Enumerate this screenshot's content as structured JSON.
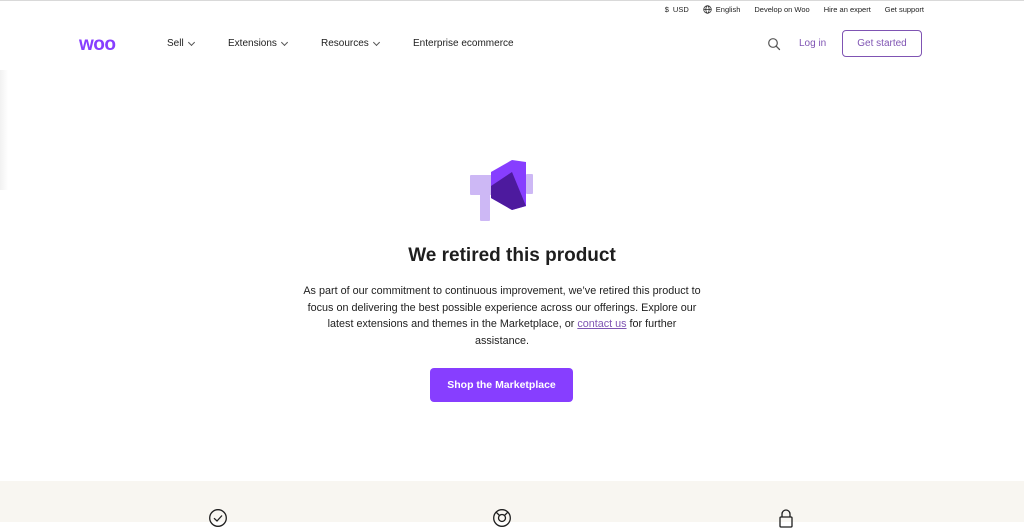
{
  "utility_bar": {
    "currency": "USD",
    "currency_icon": "dollar-icon",
    "language": "English",
    "language_icon": "globe-icon",
    "links": [
      "Develop on Woo",
      "Hire an expert",
      "Get support"
    ]
  },
  "header": {
    "logo_text": "woo",
    "nav": [
      {
        "label": "Sell",
        "dropdown": true
      },
      {
        "label": "Extensions",
        "dropdown": true
      },
      {
        "label": "Resources",
        "dropdown": true
      },
      {
        "label": "Enterprise ecommerce",
        "dropdown": false
      }
    ],
    "search_icon": "search-icon",
    "login_label": "Log in",
    "get_started_label": "Get started"
  },
  "main": {
    "icon": "megaphone-icon",
    "title": "We retired this product",
    "body_part1": "As part of our commitment to continuous improvement, we’ve retired this product to focus on delivering the best possible experience across our offerings. Explore our latest extensions and themes in the Marketplace, or",
    "contact_link": "contact us",
    "body_part2": "for further assistance.",
    "cta_label": "Shop the Marketplace"
  },
  "footer": {
    "icons": [
      "check-circle-icon",
      "support-icon",
      "lock-icon"
    ]
  },
  "colors": {
    "brand": "#7f54b3",
    "cta": "#873eff",
    "footer_bg": "#f8f6f1"
  }
}
